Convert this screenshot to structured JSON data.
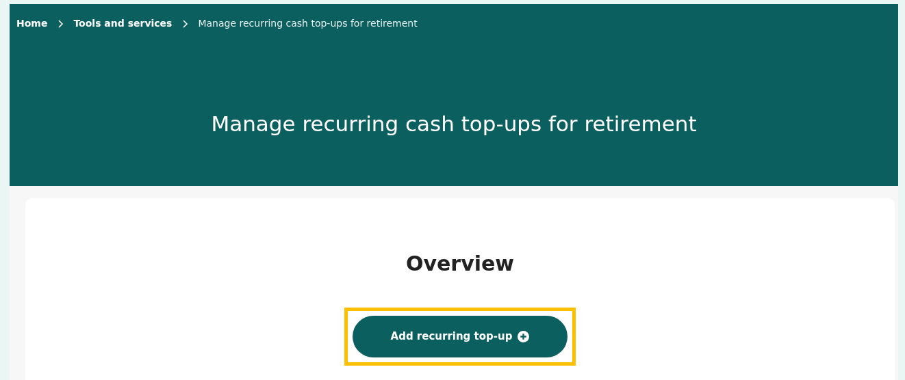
{
  "breadcrumb": [
    {
      "label": "Home",
      "current": false
    },
    {
      "label": "Tools and services",
      "current": false
    },
    {
      "label": "Manage recurring cash top-ups for retirement",
      "current": true
    }
  ],
  "page_title": "Manage recurring cash top-ups for retirement",
  "overview": {
    "heading": "Overview",
    "button": {
      "label": "Add recurring top-up",
      "highlighted": true
    }
  }
}
